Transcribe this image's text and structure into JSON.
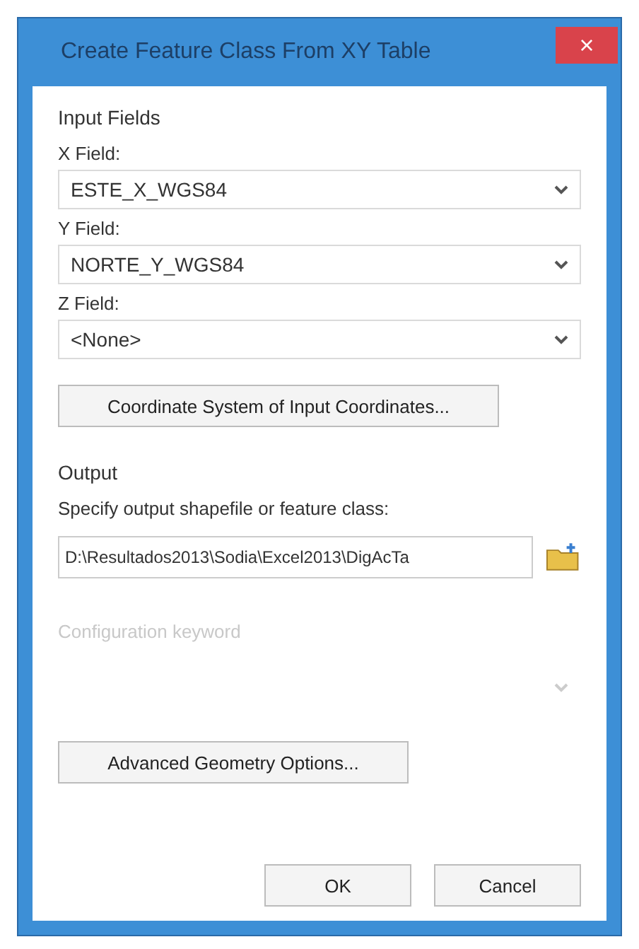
{
  "window": {
    "title": "Create Feature Class From XY Table",
    "close": "×"
  },
  "input_fields": {
    "heading": "Input Fields",
    "fields": [
      {
        "label": "X Field:",
        "value": "ESTE_X_WGS84"
      },
      {
        "label": "Y Field:",
        "value": "NORTE_Y_WGS84"
      },
      {
        "label": "Z Field:",
        "value": "<None>"
      }
    ]
  },
  "coordinate_button": "Coordinate System of Input Coordinates...",
  "output": {
    "heading": "Output",
    "prompt": "Specify output shapefile or feature class:",
    "path": "D:\\Resultados2013\\Sodia\\Excel2013\\DigAcTa"
  },
  "configuration": {
    "label": "Configuration keyword",
    "disabled": true
  },
  "advanced_button": "Advanced Geometry Options...",
  "buttons": [
    "OK",
    "Cancel"
  ]
}
